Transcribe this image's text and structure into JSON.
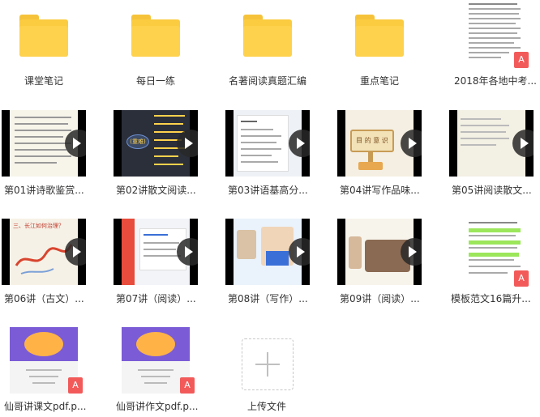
{
  "row1": [
    {
      "label": "课堂笔记",
      "type": "folder"
    },
    {
      "label": "每日一练",
      "type": "folder"
    },
    {
      "label": "名著阅读真题汇编",
      "type": "folder"
    },
    {
      "label": "重点笔记",
      "type": "folder"
    },
    {
      "label": "2018年各地中考...",
      "type": "pdf"
    }
  ],
  "row2": [
    {
      "label": "第01讲诗歌鉴赏..."
    },
    {
      "label": "第02讲散文阅读..."
    },
    {
      "label": "第03讲语基高分..."
    },
    {
      "label": "第04讲写作品味..."
    },
    {
      "label": "第05讲阅读散文..."
    }
  ],
  "row3": [
    {
      "label": "第06讲（古文）..."
    },
    {
      "label": "第07讲（阅读）..."
    },
    {
      "label": "第08讲（写作）..."
    },
    {
      "label": "第09讲（阅读）..."
    },
    {
      "label": "模板范文16篇升..."
    }
  ],
  "row4": [
    {
      "label": "仙哥讲课文pdf.p..."
    },
    {
      "label": "仙哥讲作文pdf.p..."
    },
    {
      "label": "上传文件"
    }
  ],
  "thumb_text": {
    "t02_bubble": "(重难)",
    "t06_title": "三、长江如何治理？",
    "t04_sign": "目 的 意 识"
  },
  "pdf_badge_glyph": "A",
  "colors": {
    "folder": "#fccc40",
    "pdf_badge": "#f25a5a",
    "play_button": "#282828"
  }
}
